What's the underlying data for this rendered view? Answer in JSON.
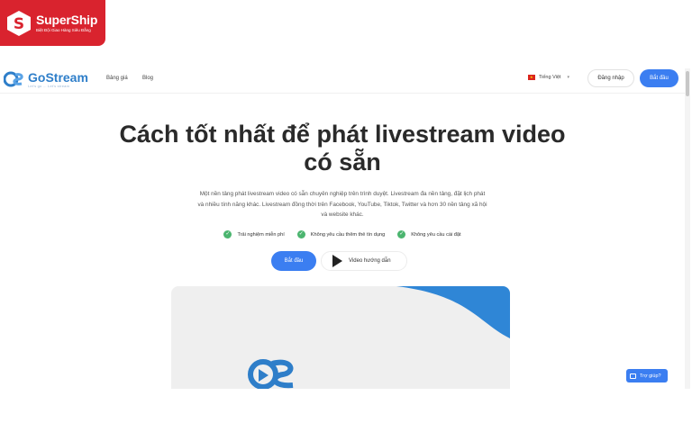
{
  "overlay": {
    "name": "SuperShip",
    "tagline": "Biệt Đội Giao Hàng Siêu Đẳng",
    "color": "#d9232e"
  },
  "header": {
    "brand_name": "GoStream",
    "brand_tagline": "Let's go ... Let's stream",
    "nav": {
      "pricing": "Bảng giá",
      "blog": "Blog"
    },
    "language": "Tiếng Việt",
    "login_label": "Đăng nhập",
    "start_label": "Bắt đầu"
  },
  "hero": {
    "title_line1": "Cách tốt nhất để phát livestream video",
    "title_line2": "có sẵn",
    "desc_line1": "Một nền tảng phát livestream video có sẵn chuyên nghiệp trên trình duyệt. Livestream đa nền tảng, đặt lịch phát",
    "desc_line2": "và nhiều tính năng khác. Livestream đồng thời trên Facebook, YouTube, Tiktok, Twitter và hơn 30 nền tảng xã hội",
    "desc_line3": "và website khác.",
    "features": [
      "Trải nghiệm miễn phí",
      "Không yêu cầu thêm thẻ tín dụng",
      "Không yêu cầu cài đặt"
    ],
    "start_label": "Bắt đầu",
    "video_label": "Video hướng dẫn"
  },
  "help": {
    "label": "Trợ giúp?"
  },
  "colors": {
    "accent": "#3b7ef1",
    "brand": "#2e7ec9",
    "check": "#4bb56f"
  }
}
